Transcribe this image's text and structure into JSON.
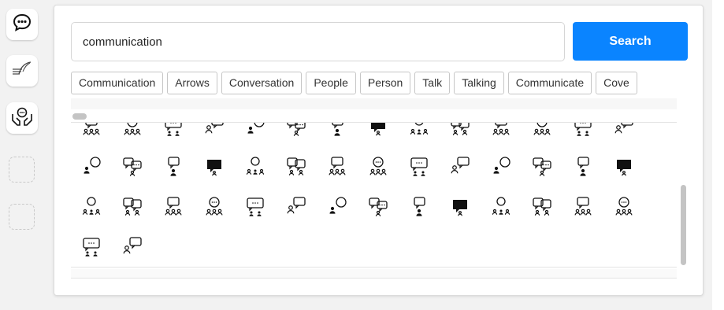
{
  "search": {
    "value": "communication",
    "button_label": "Search"
  },
  "tags": [
    "Communication",
    "Arrows",
    "Conversation",
    "People",
    "Person",
    "Talk",
    "Talking",
    "Communicate",
    "Cove"
  ],
  "rail": {
    "items": [
      {
        "icon": "chat-bubble-icon"
      },
      {
        "icon": "feather-lines-icon"
      },
      {
        "icon": "hands-chat-icon"
      }
    ]
  },
  "icons": [
    "group-talk-icon",
    "globe-people-icon",
    "network-people-icon",
    "cloud-icon",
    "people-board-icon",
    "person-speech-icon",
    "speech-icon",
    "heads-talk-icon",
    "chat-pair-icon",
    "people-chat-icon",
    "person-message-icon",
    "presenter-icon",
    "team-board-icon",
    "signpost-icon",
    "meeting-board-icon",
    "person-bubble-icon",
    "desk-chat-icon",
    "person-dots-icon",
    "screens-people-icon",
    "group-bubble-icon",
    "team-bubble-icon",
    "chat-screen-icon",
    "presentation-icon",
    "leader-bubble-icon",
    "person-bubble-icon",
    "team-chat-icon",
    "group-speech-icon",
    "board-people-icon",
    "group-bubble-icon",
    "persons-chat-icon",
    "people-message-icon",
    "team-speech-icon",
    "meeting-chat-icon",
    "group-dots-icon",
    "person-flag-icon",
    "persons-board-icon",
    "audience-bubble-icon",
    "team-bubble-icon",
    "discussion-icon",
    "meeting-room-icon",
    "speaker-bubble-icon",
    "circle-talk-icon",
    "team-chat-icon",
    "hands-chat-icon"
  ]
}
